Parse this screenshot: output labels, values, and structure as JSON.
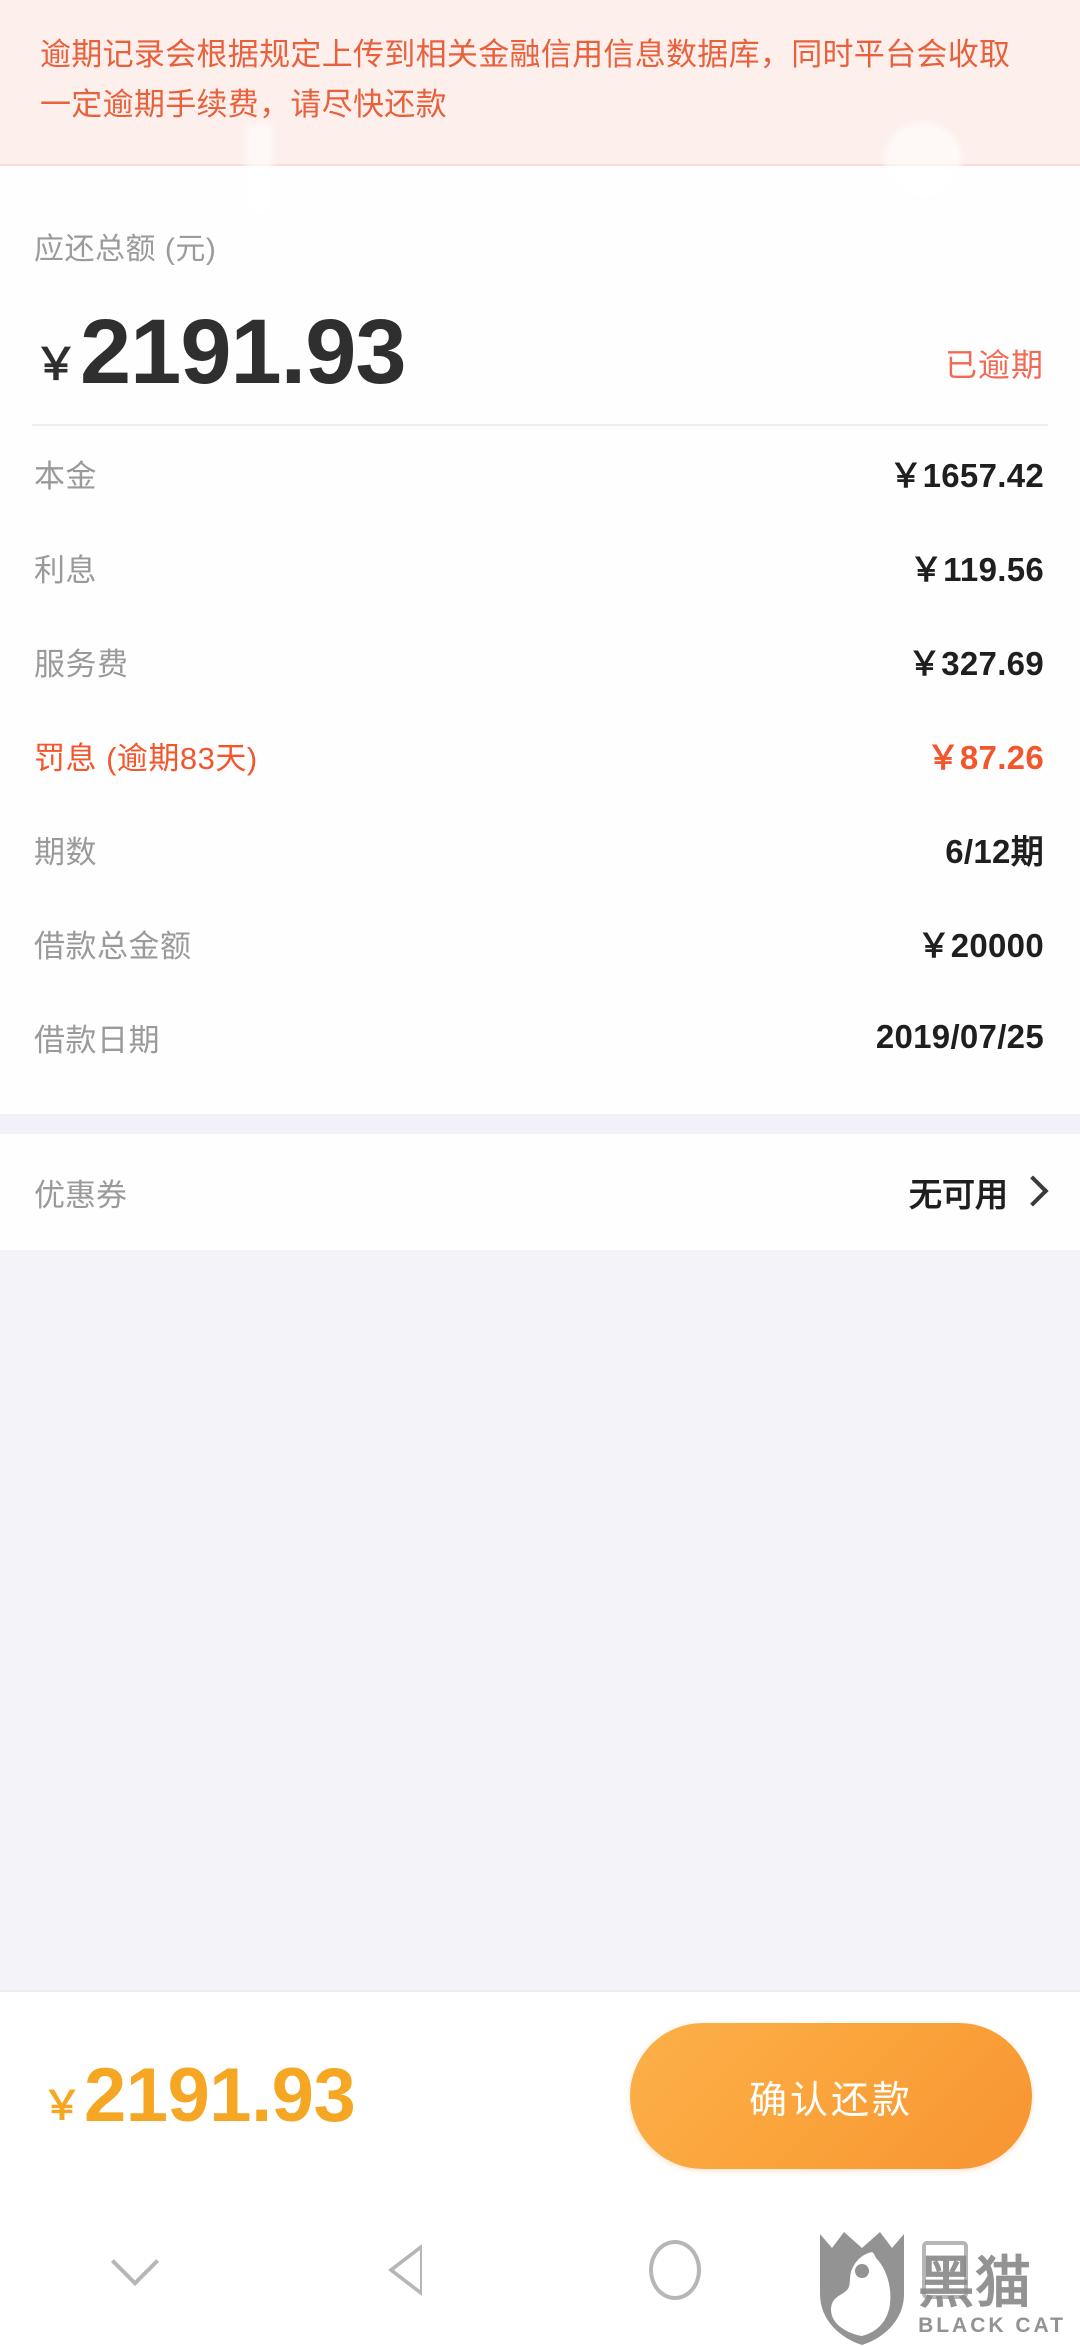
{
  "banner": {
    "text": "逾期记录会根据规定上传到相关金融信用信息数据库，同时平台会收取一定逾期手续费，请尽快还款",
    "text_color": "#e8603c",
    "background_color": "#fdf0ec"
  },
  "summary": {
    "total_label": "应还总额 (元)",
    "currency_symbol": "￥",
    "total_amount": "2191.93",
    "status_badge": "已逾期",
    "status_color": "#f26a54"
  },
  "details": {
    "rows": [
      {
        "label": "本金",
        "value": "￥1657.42",
        "accent": false
      },
      {
        "label": "利息",
        "value": "￥119.56",
        "accent": false
      },
      {
        "label": "服务费",
        "value": "￥327.69",
        "accent": false
      },
      {
        "label": "罚息 (逾期83天)",
        "value": "￥87.26",
        "accent": true
      },
      {
        "label": "期数",
        "value": "6/12期",
        "accent": false
      },
      {
        "label": "借款总金额",
        "value": "￥20000",
        "accent": false
      },
      {
        "label": "借款日期",
        "value": "2019/07/25",
        "accent": false
      }
    ],
    "accent_color": "#f4562c"
  },
  "coupon": {
    "label": "优惠券",
    "value": "无可用",
    "chevron": "chevron-right-icon"
  },
  "bottom_bar": {
    "currency_symbol": "￥",
    "amount": "2191.93",
    "amount_color": "#f5a623",
    "confirm_label": "确认还款",
    "button_color": "#fba53c"
  },
  "nav_bar": {
    "items": [
      {
        "icon": "chevron-down-icon",
        "label": "收起键盘"
      },
      {
        "icon": "back-triangle-icon",
        "label": "返回"
      },
      {
        "icon": "home-circle-icon",
        "label": "主页"
      },
      {
        "icon": "recents-square-icon",
        "label": "最近任务"
      }
    ]
  },
  "watermark": {
    "cn_text": "黑猫",
    "en_text": "BLACK CAT",
    "color": "#8a8a8a"
  }
}
